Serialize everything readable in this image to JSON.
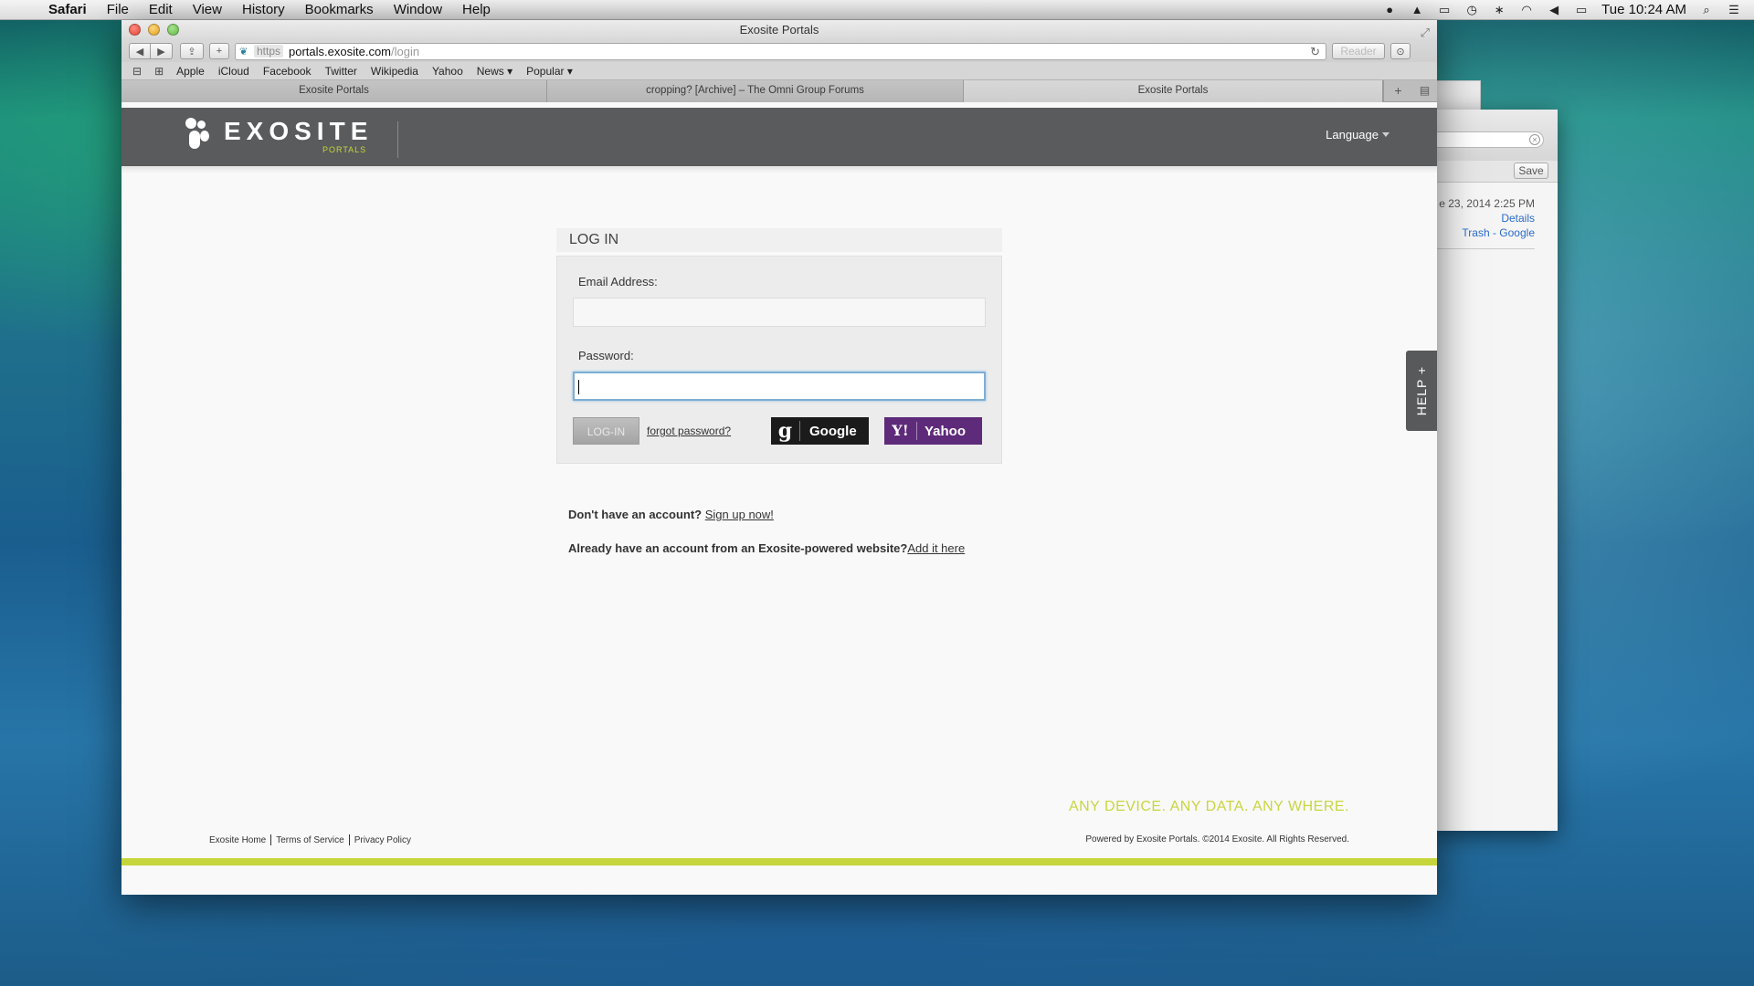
{
  "menubar": {
    "app": "Safari",
    "items": [
      "File",
      "Edit",
      "View",
      "History",
      "Bookmarks",
      "Window",
      "Help"
    ],
    "clock": "Tue 10:24 AM"
  },
  "window": {
    "title": "Exosite Portals"
  },
  "toolbar": {
    "address_scheme": "https",
    "address_host": "portals.exosite.com",
    "address_path": "/login",
    "reader_label": "Reader"
  },
  "bookmarks": [
    "Apple",
    "iCloud",
    "Facebook",
    "Twitter",
    "Wikipedia",
    "Yahoo",
    "News ▾",
    "Popular ▾"
  ],
  "tabs": [
    {
      "label": "Exosite Portals"
    },
    {
      "label": "cropping? [Archive] – The Omni Group Forums"
    },
    {
      "label": "Exosite Portals"
    }
  ],
  "header": {
    "logo_word": "EXOSITE",
    "logo_sub": "PORTALS",
    "language_label": "Language"
  },
  "login": {
    "title": "LOG IN",
    "email_label": "Email Address:",
    "email_value": "",
    "password_label": "Password:",
    "password_value": "",
    "login_button": "LOG-IN",
    "forgot_link": "forgot password?",
    "google_button": "Google",
    "yahoo_button": "Yahoo",
    "google_glyph": "g",
    "yahoo_glyph": "Y!"
  },
  "signup": {
    "prompt": "Don't have an account?",
    "link": "Sign up now!",
    "already_prompt": "Already have an account from an Exosite-powered website?",
    "already_link": "Add it here"
  },
  "help_tab": "HELP +",
  "footer": {
    "tagline": "ANY DEVICE. ANY DATA. ANY WHERE.",
    "links": [
      "Exosite Home",
      "Terms of Service",
      "Privacy Policy"
    ],
    "copyright": "Powered by Exosite Portals. ©2014 Exosite. All Rights Reserved."
  },
  "background_window": {
    "save_label": "Save",
    "date_text": "e 23, 2014  2:25 PM",
    "link1": "Details",
    "link2": "Trash - Google"
  },
  "colors": {
    "brand_green": "#c6d63a",
    "header_gray": "#5a5b5d",
    "yahoo_purple": "#5e2a7a",
    "google_black": "#1b1b1b"
  }
}
